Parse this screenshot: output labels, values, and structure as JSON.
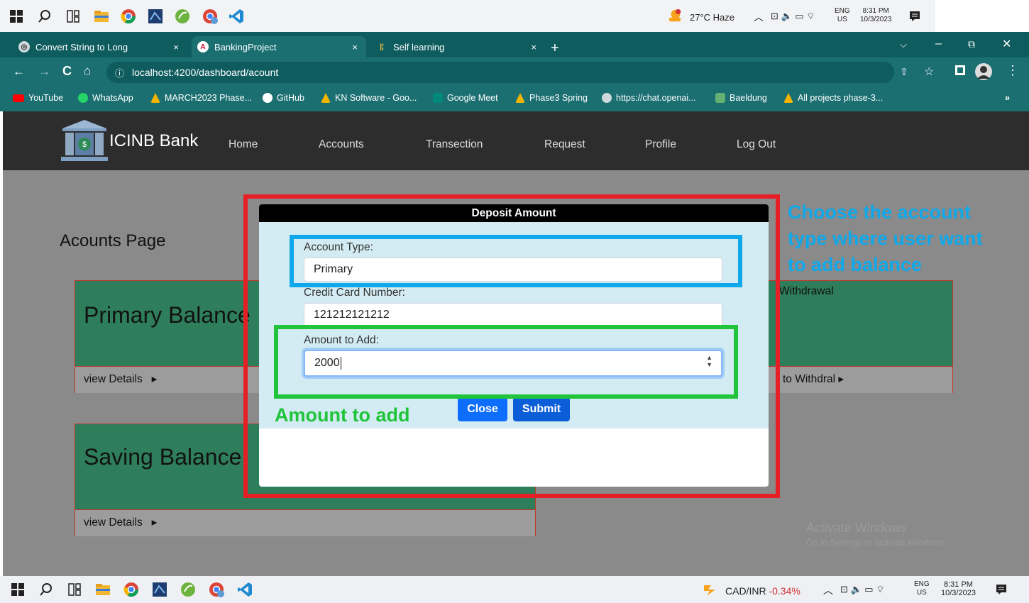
{
  "taskbar_top": {
    "weather": "27°C  Haze",
    "lang_top": "ENG",
    "lang_bottom": "US",
    "time": "8:31 PM",
    "date": "10/3/2023"
  },
  "browser": {
    "tabs": [
      {
        "label": "Convert String to Long",
        "close": "×"
      },
      {
        "label": "BankingProject",
        "close": "×"
      },
      {
        "label": "Self learning",
        "close": "×"
      }
    ],
    "new_tab": "+",
    "url": "localhost:4200/dashboard/acount",
    "bookmarks": [
      "YouTube",
      "WhatsApp",
      "MARCH2023 Phase...",
      "GitHub",
      "KN Software - Goo...",
      "Google Meet",
      "Phase3 Spring",
      "https://chat.openai...",
      "Baeldung",
      "All projects phase-3..."
    ],
    "more_bookmarks": "»"
  },
  "app": {
    "brand": "ICINB Bank",
    "nav": [
      "Home",
      "Accounts",
      "Transection",
      "Request",
      "Profile",
      "Log Out"
    ]
  },
  "page": {
    "title": "Acounts Page",
    "cards": [
      {
        "title": "Primary Balance",
        "link": "view Details"
      },
      {
        "title": "Saving Balance",
        "link": "view Details"
      }
    ],
    "right_card": {
      "title": "Withdrawal",
      "link": "to Withdral"
    },
    "watermark_line1": "Activate Windows",
    "watermark_line2": "Go to Settings to activate Windows."
  },
  "modal": {
    "title": "Deposit Amount",
    "account_type_label": "Account Type:",
    "account_type_value": "Primary",
    "card_number_label": "Credit Card Number:",
    "card_number_value": "121212121212",
    "amount_label": "Amount to Add:",
    "amount_value": "2000",
    "close_button": "Close",
    "submit_button": "Submit"
  },
  "annotations": {
    "account_type_note": [
      "Choose the account",
      "type where user want",
      "to add balance"
    ],
    "amount_note": "Amount to add"
  },
  "taskbar_bottom": {
    "ticker_name": "CAD/INR",
    "ticker_change": "-0.34%",
    "lang_top": "ENG",
    "lang_bottom": "US",
    "time": "8:31 PM",
    "date": "10/3/2023"
  },
  "colors": {
    "red_outline": "#e61e25",
    "blue_annotation": "#0fa8ea",
    "green_annotation": "#1fc43a",
    "tab_bg": "#0f5c5e",
    "nav_bg": "#2d2d2d",
    "button_blue": "#0d6efd"
  }
}
